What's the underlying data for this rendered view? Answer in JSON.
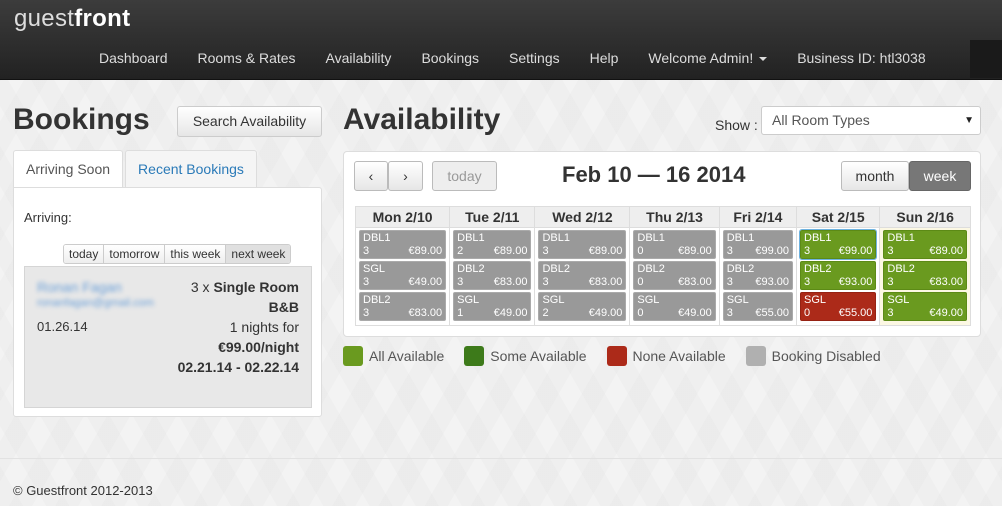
{
  "brand": {
    "light": "guest",
    "bold": "front"
  },
  "nav": {
    "dashboard": "Dashboard",
    "rooms": "Rooms & Rates",
    "availability": "Availability",
    "bookings": "Bookings",
    "settings": "Settings",
    "help": "Help",
    "welcome": "Welcome Admin!",
    "business": "Business ID: htl3038"
  },
  "left": {
    "title": "Bookings",
    "search_button": "Search Availability",
    "tabs": [
      "Arriving Soon",
      "Recent Bookings"
    ],
    "arriving_label": "Arriving:",
    "filters": [
      "today",
      "tomorrow",
      "this week",
      "next week"
    ],
    "booking": {
      "name": "Ronan Fagan",
      "email": "ronanfagan@gmail.com",
      "date": "01.26.14",
      "qty": "3 x",
      "room": "Single Room",
      "board": "B&B",
      "nights": "1 nights for",
      "price": "€99.00/night",
      "range": "02.21.14 - 02.22.14"
    }
  },
  "availability": {
    "title": "Availability",
    "show_label": "Show :",
    "room_select": "All Room Types",
    "prev": "‹",
    "next": "›",
    "today": "today",
    "range_title": "Feb 10 — 16 2014",
    "month": "month",
    "week": "week",
    "days": [
      {
        "label": "Mon 2/10",
        "slots": [
          {
            "t": "DBL1",
            "c": "3",
            "p": "€89.00",
            "s": "disabled"
          },
          {
            "t": "SGL",
            "c": "3",
            "p": "€49.00",
            "s": "disabled"
          },
          {
            "t": "DBL2",
            "c": "3",
            "p": "€83.00",
            "s": "disabled"
          }
        ]
      },
      {
        "label": "Tue 2/11",
        "slots": [
          {
            "t": "DBL1",
            "c": "2",
            "p": "€89.00",
            "s": "disabled"
          },
          {
            "t": "DBL2",
            "c": "3",
            "p": "€83.00",
            "s": "disabled"
          },
          {
            "t": "SGL",
            "c": "1",
            "p": "€49.00",
            "s": "disabled"
          }
        ]
      },
      {
        "label": "Wed 2/12",
        "slots": [
          {
            "t": "DBL1",
            "c": "3",
            "p": "€89.00",
            "s": "disabled"
          },
          {
            "t": "DBL2",
            "c": "3",
            "p": "€83.00",
            "s": "disabled"
          },
          {
            "t": "SGL",
            "c": "2",
            "p": "€49.00",
            "s": "disabled"
          }
        ]
      },
      {
        "label": "Thu 2/13",
        "slots": [
          {
            "t": "DBL1",
            "c": "0",
            "p": "€89.00",
            "s": "disabled"
          },
          {
            "t": "DBL2",
            "c": "0",
            "p": "€83.00",
            "s": "disabled"
          },
          {
            "t": "SGL",
            "c": "0",
            "p": "€49.00",
            "s": "disabled"
          }
        ]
      },
      {
        "label": "Fri 2/14",
        "slots": [
          {
            "t": "DBL1",
            "c": "3",
            "p": "€99.00",
            "s": "disabled"
          },
          {
            "t": "DBL2",
            "c": "3",
            "p": "€93.00",
            "s": "disabled"
          },
          {
            "t": "SGL",
            "c": "3",
            "p": "€55.00",
            "s": "disabled"
          }
        ]
      },
      {
        "label": "Sat 2/15",
        "slots": [
          {
            "t": "DBL1",
            "c": "3",
            "p": "€99.00",
            "s": "all"
          },
          {
            "t": "DBL2",
            "c": "3",
            "p": "€93.00",
            "s": "all"
          },
          {
            "t": "SGL",
            "c": "0",
            "p": "€55.00",
            "s": "none"
          }
        ]
      },
      {
        "label": "Sun 2/16",
        "slots": [
          {
            "t": "DBL1",
            "c": "3",
            "p": "€89.00",
            "s": "all"
          },
          {
            "t": "DBL2",
            "c": "3",
            "p": "€83.00",
            "s": "all"
          },
          {
            "t": "SGL",
            "c": "3",
            "p": "€49.00",
            "s": "all"
          }
        ]
      }
    ],
    "legend": [
      {
        "label": "All Available",
        "color": "#6a9a1f"
      },
      {
        "label": "Some Available",
        "color": "#3d7a1a"
      },
      {
        "label": "None Available",
        "color": "#ac2a19"
      },
      {
        "label": "Booking Disabled",
        "color": "#b0b0b0"
      }
    ]
  },
  "footer": "© Guestfront 2012-2013"
}
